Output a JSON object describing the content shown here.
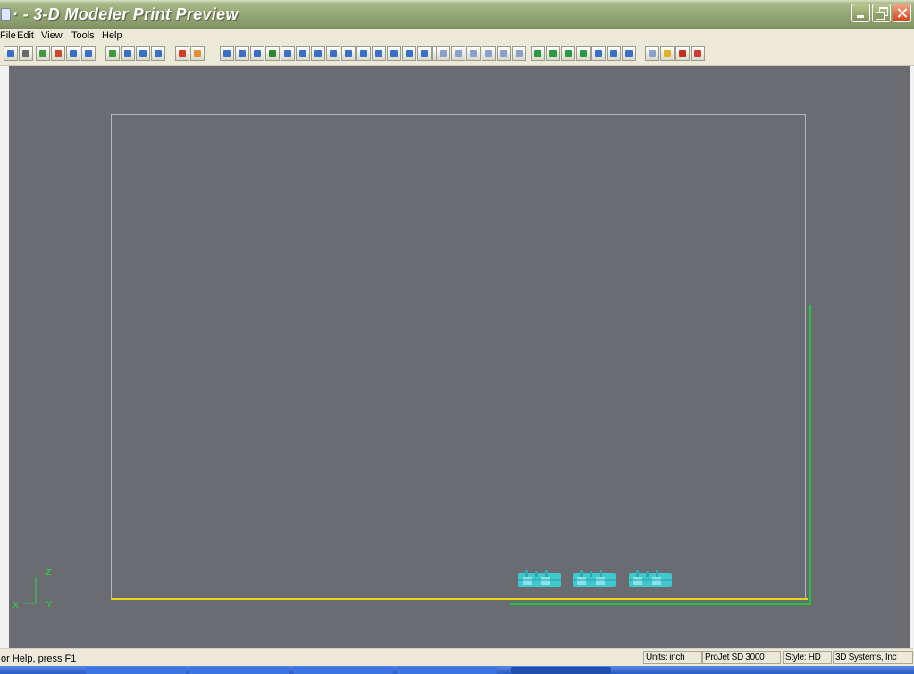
{
  "window": {
    "title": "· - 3-D Modeler Print Preview"
  },
  "title_buttons": {
    "minimize": "minimize",
    "maximize": "restore",
    "close": "close"
  },
  "menu": [
    "File",
    "Edit",
    "View",
    "Tools",
    "Help"
  ],
  "toolbar_icon_names": [
    "open-icon",
    "save-icon",
    "print-icon",
    "settings-icon",
    "view-icon",
    "zoom-icon",
    "rotate-icon",
    "pan-icon",
    "measure-icon",
    "fit-icon"
  ],
  "axis_triad": {
    "x": "X",
    "y": "Y",
    "z": "Z"
  },
  "parts": {
    "count": 3
  },
  "colors": {
    "viewport": "#6a6c72",
    "platform_edge": "#e6d419",
    "bounds": "#21c53a",
    "part": "#3fc9cf"
  },
  "status": {
    "help": "or Help, press F1",
    "units": "Units: inch",
    "printer": "ProJet SD 3000",
    "style": "Style: HD",
    "company": "3D Systems, Inc"
  }
}
